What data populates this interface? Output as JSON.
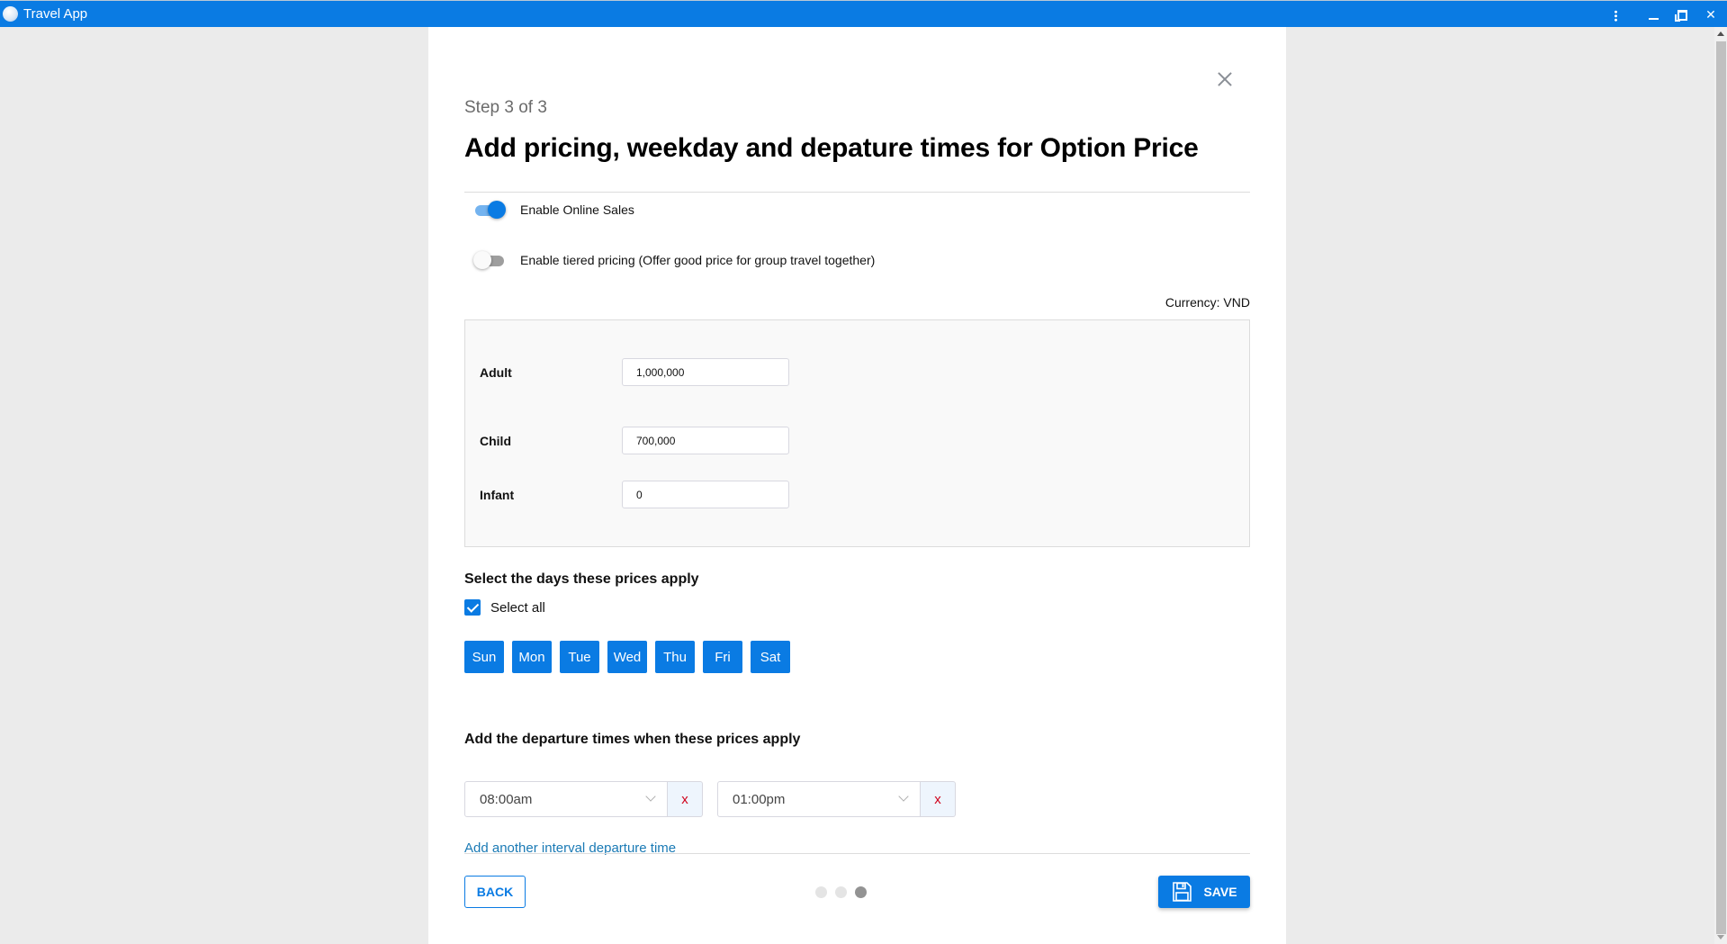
{
  "window": {
    "title": "Travel App",
    "controls": {
      "menu": "more-vert-icon",
      "minimize": "minimize-icon",
      "restore": "restore-icon",
      "close": "close-icon"
    }
  },
  "dialog": {
    "step_label": "Step 3 of 3",
    "title": "Add pricing, weekday and depature times for Option Price",
    "toggles": [
      {
        "label": "Enable Online Sales",
        "on": true
      },
      {
        "label": "Enable tiered pricing (Offer good price for group travel together)",
        "on": false
      }
    ],
    "currency_label": "Currency: VND",
    "prices": [
      {
        "label": "Adult",
        "value": "1,000,000"
      },
      {
        "label": "Child",
        "value": "700,000"
      },
      {
        "label": "Infant",
        "value": "0"
      }
    ],
    "days_section": {
      "heading": "Select the days these prices apply",
      "select_all_label": "Select all",
      "select_all_checked": true,
      "days": [
        "Sun",
        "Mon",
        "Tue",
        "Wed",
        "Thu",
        "Fri",
        "Sat"
      ]
    },
    "departure_section": {
      "heading": "Add the departure times when these prices apply",
      "times": [
        {
          "value": "08:00am",
          "remove_label": "x"
        },
        {
          "value": "01:00pm",
          "remove_label": "x"
        }
      ],
      "add_link": "Add another interval departure time"
    },
    "footer": {
      "back_label": "BACK",
      "save_label": "SAVE",
      "steps_total": 3,
      "current_step": 3
    }
  },
  "colors": {
    "accent": "#0a7be3",
    "link": "#1a7ab5",
    "remove": "#d0021b"
  }
}
